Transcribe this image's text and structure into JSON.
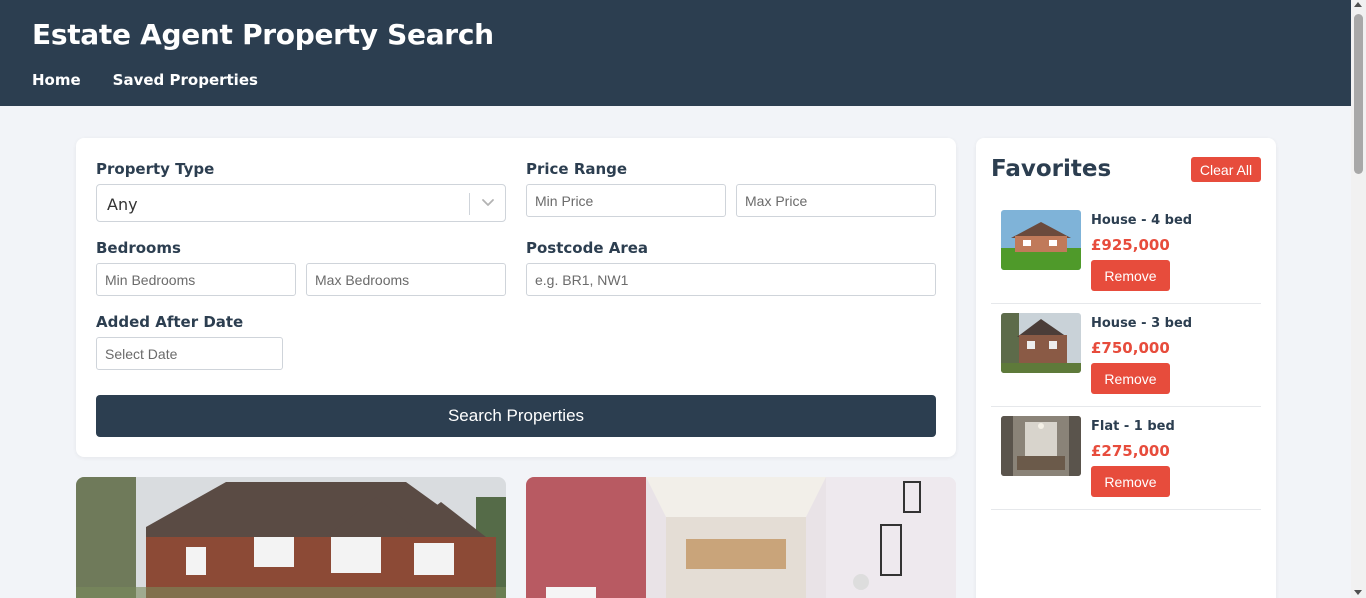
{
  "header": {
    "title": "Estate Agent Property Search",
    "nav": [
      "Home",
      "Saved Properties"
    ]
  },
  "search": {
    "property_type_label": "Property Type",
    "property_type_value": "Any",
    "price_range_label": "Price Range",
    "min_price_placeholder": "Min Price",
    "max_price_placeholder": "Max Price",
    "bedrooms_label": "Bedrooms",
    "min_bedrooms_placeholder": "Min Bedrooms",
    "max_bedrooms_placeholder": "Max Bedrooms",
    "postcode_label": "Postcode Area",
    "postcode_placeholder": "e.g. BR1, NW1",
    "date_label": "Added After Date",
    "date_placeholder": "Select Date",
    "button_label": "Search Properties"
  },
  "favorites": {
    "title": "Favorites",
    "clear_label": "Clear All",
    "items": [
      {
        "name": "House - 4 bed",
        "price": "£925,000",
        "remove_label": "Remove"
      },
      {
        "name": "House - 3 bed",
        "price": "£750,000",
        "remove_label": "Remove"
      },
      {
        "name": "Flat - 1 bed",
        "price": "£275,000",
        "remove_label": "Remove"
      }
    ]
  },
  "colors": {
    "header_bg": "#2c3e50",
    "accent_red": "#e74c3c",
    "page_bg": "#f2f4f8"
  }
}
